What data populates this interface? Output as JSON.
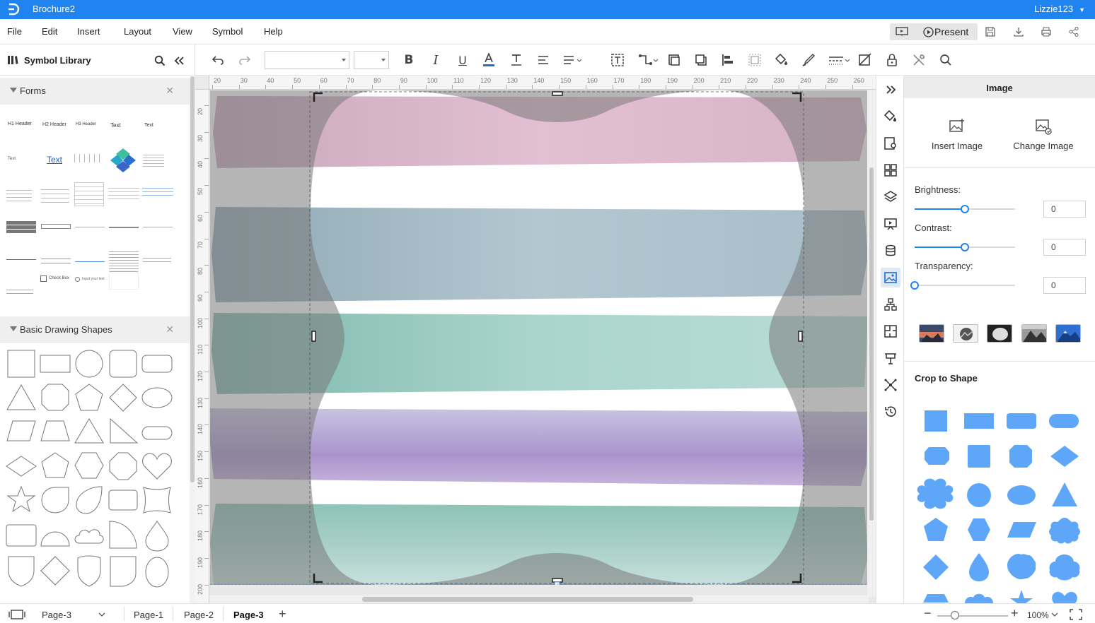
{
  "app": {
    "document_title": "Brochure2",
    "user_name": "Lizzie123"
  },
  "menu": {
    "items": [
      "File",
      "Edit",
      "Insert",
      "Layout",
      "View",
      "Symbol",
      "Help"
    ],
    "present_label": "Present"
  },
  "symbol_library": {
    "title": "Symbol Library",
    "sections": [
      {
        "label": "Forms"
      },
      {
        "label": "Basic Drawing Shapes"
      }
    ],
    "forms_items": {
      "h1": "H1 Header",
      "h2": "H2 Header",
      "h3": "H3 Header",
      "text1": "Text",
      "text2": "Text",
      "text3": "Text",
      "link_text": "Text",
      "checkbox": "Check Box",
      "radio": "Input your text"
    }
  },
  "toolbar": {
    "font_value": "",
    "size_value": ""
  },
  "ruler": {
    "top_ticks": [
      "20",
      "30",
      "40",
      "50",
      "60",
      "70",
      "80",
      "90",
      "100",
      "110",
      "120",
      "130",
      "140",
      "150",
      "160",
      "170",
      "180",
      "190",
      "200",
      "210",
      "220",
      "230",
      "240",
      "250",
      "260"
    ],
    "left_ticks": [
      "20",
      "30",
      "40",
      "50",
      "60",
      "70",
      "80",
      "90",
      "100",
      "110",
      "120",
      "130",
      "140",
      "150",
      "160",
      "170",
      "180",
      "190",
      "200"
    ]
  },
  "properties": {
    "panel_title": "Image",
    "insert_image": "Insert Image",
    "change_image": "Change Image",
    "brightness_label": "Brightness:",
    "brightness_value": "0",
    "brightness_level": 0.5,
    "contrast_label": "Contrast:",
    "contrast_value": "0",
    "contrast_level": 0.5,
    "transparency_label": "Transparency:",
    "transparency_value": "0",
    "transparency_level": 0,
    "crop_title": "Crop to Shape",
    "accent_color": "#1f84f0",
    "shape_color": "#5ea6f7"
  },
  "pages": {
    "current_selector": "Page-3",
    "tabs": [
      "Page-1",
      "Page-2",
      "Page-3"
    ],
    "active_tab": "Page-3",
    "zoom": "100%"
  }
}
